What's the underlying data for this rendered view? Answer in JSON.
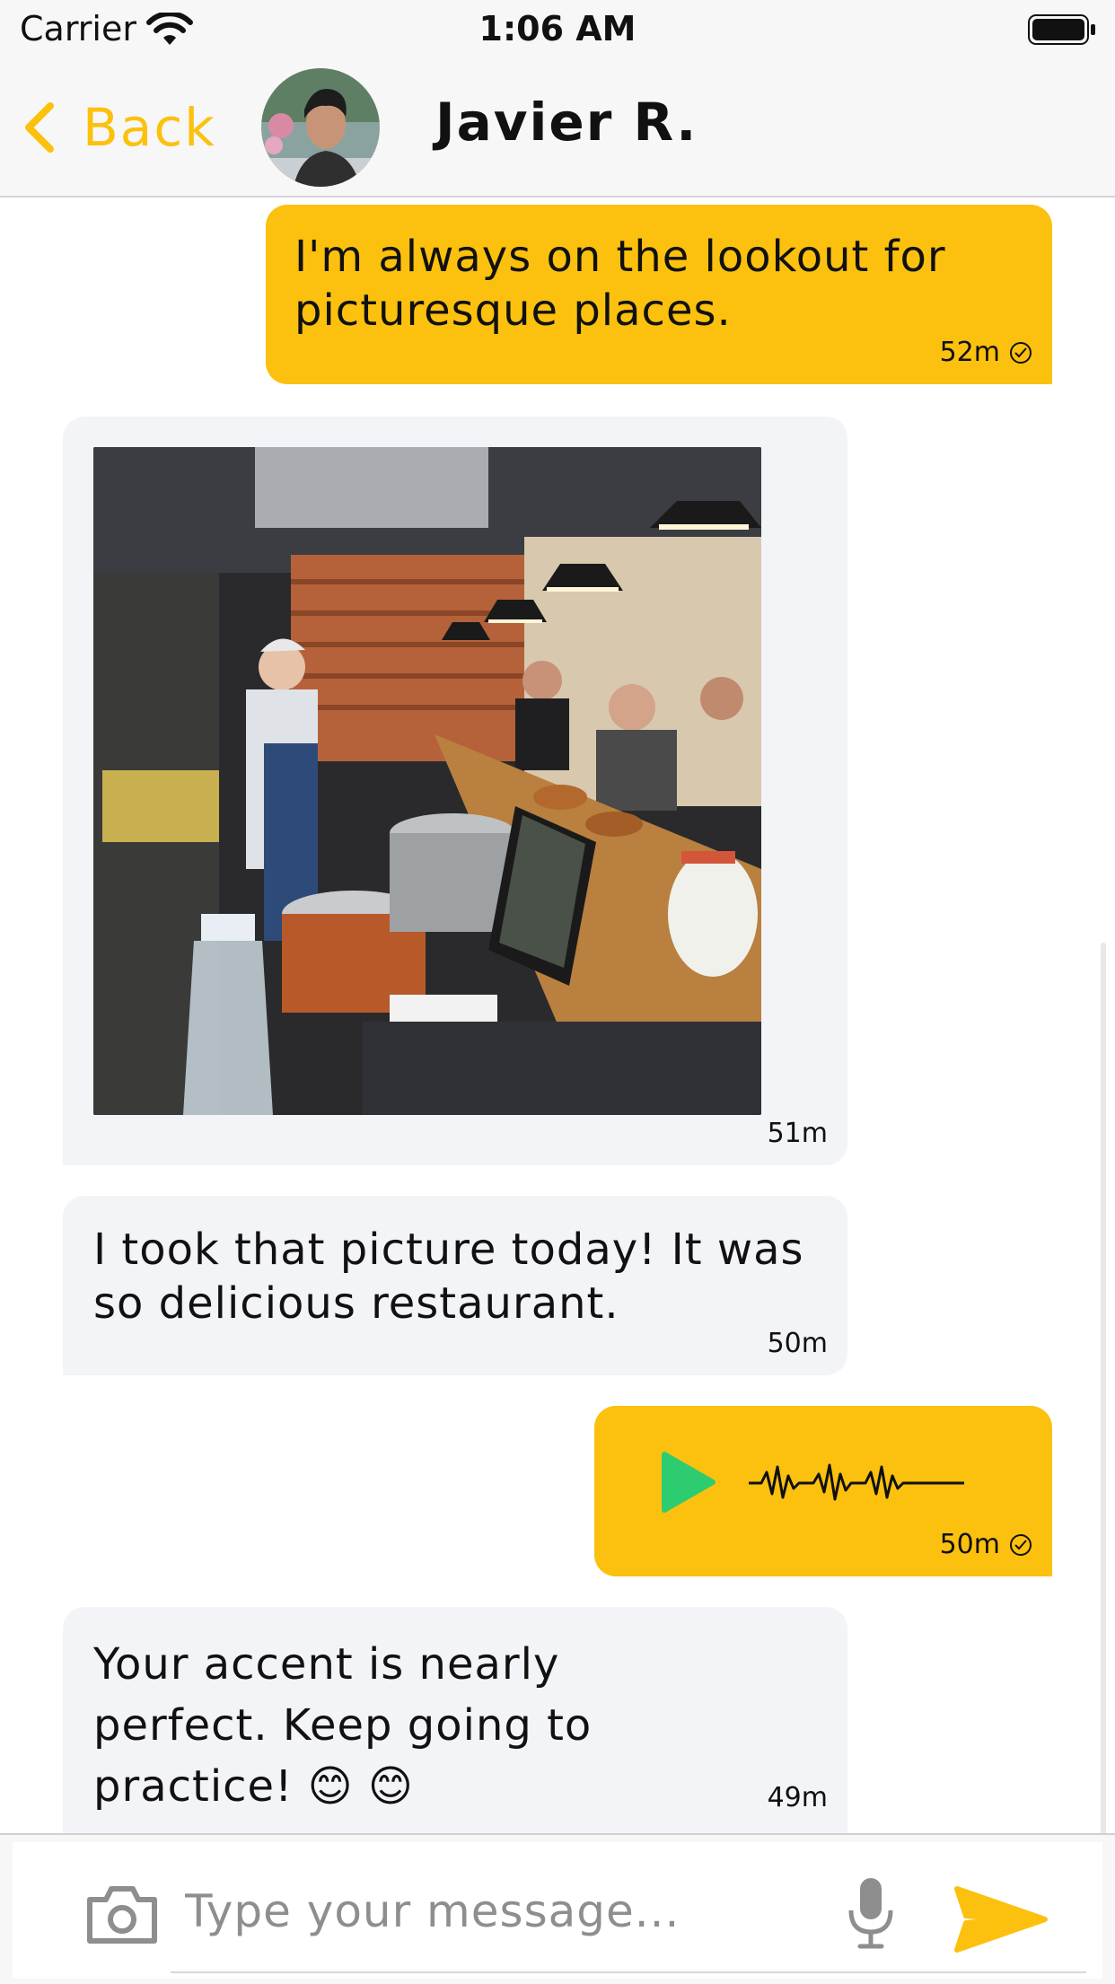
{
  "status_bar": {
    "carrier": "Carrier",
    "time": "1:06 AM"
  },
  "header": {
    "back_label": "Back",
    "contact_name": "Javier R."
  },
  "colors": {
    "accent": "#fcc10e",
    "incoming_bubble": "#f3f4f8",
    "play_button": "#2ecc71"
  },
  "messages": [
    {
      "direction": "outgoing",
      "type": "text",
      "text": "I'm always on the lookout for picturesque places.",
      "time": "52m",
      "status_icon": "check-circle-icon"
    },
    {
      "direction": "incoming",
      "type": "image",
      "image_description": "restaurant-kitchen-photo",
      "time": "51m"
    },
    {
      "direction": "incoming",
      "type": "text",
      "text": "I took that picture today! It was so delicious restaurant.",
      "time": "50m"
    },
    {
      "direction": "outgoing",
      "type": "voice",
      "icon": "play-icon",
      "time": "50m",
      "status_icon": "check-circle-icon"
    },
    {
      "direction": "incoming",
      "type": "text",
      "text": "Your accent is nearly perfect. Keep going to practice! 😊 😊",
      "time": "49m"
    }
  ],
  "composer": {
    "placeholder": "Type your message..."
  }
}
